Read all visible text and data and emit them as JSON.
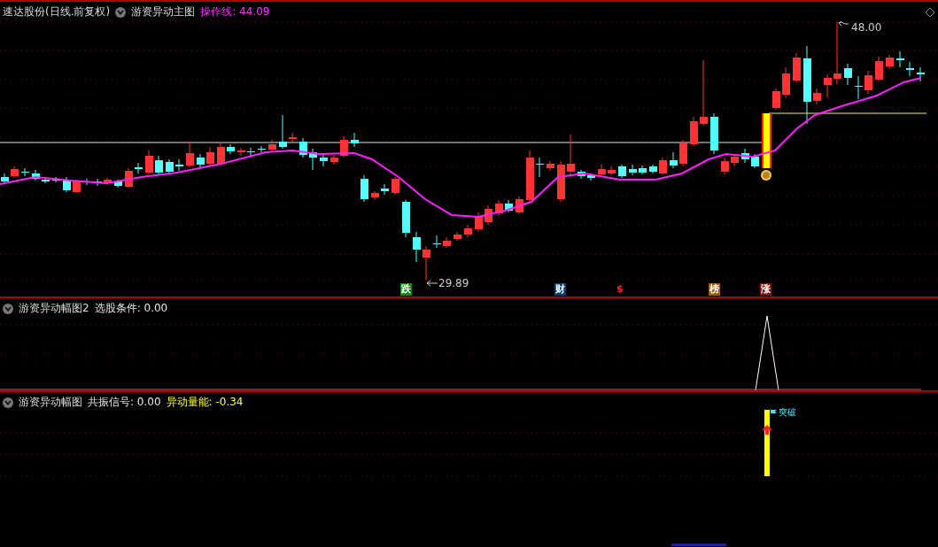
{
  "main_chart": {
    "security": "速达股份(日线.前复权)",
    "indicator": "游资异动主图",
    "line_label": "操作线: 44.09",
    "low_label": "29.89",
    "high_label": "48.00",
    "markers": [
      {
        "kind": "tag",
        "text": "跌",
        "color": "#0a8a0a"
      },
      {
        "kind": "tag",
        "text": "财",
        "color": "#0d3d6e"
      },
      {
        "kind": "symbol",
        "text": "$",
        "color": "#ff2020"
      },
      {
        "kind": "tag",
        "text": "榜",
        "color": "#a8580a"
      },
      {
        "kind": "tag",
        "text": "涨",
        "color": "#8a0a0a"
      }
    ]
  },
  "selection_panel": {
    "indicator": "游资异动幅图2",
    "fields": [
      {
        "label": "选股条件: 0.00",
        "color": "#e8e8e8"
      }
    ]
  },
  "signal_panel": {
    "indicator": "游资异动幅图",
    "fields": [
      {
        "label": "共振信号: 0.00",
        "color": "#e8e8e8"
      },
      {
        "label": "异动量能: -0.34",
        "color": "#ffff30"
      }
    ],
    "signal_label": "突破"
  }
}
